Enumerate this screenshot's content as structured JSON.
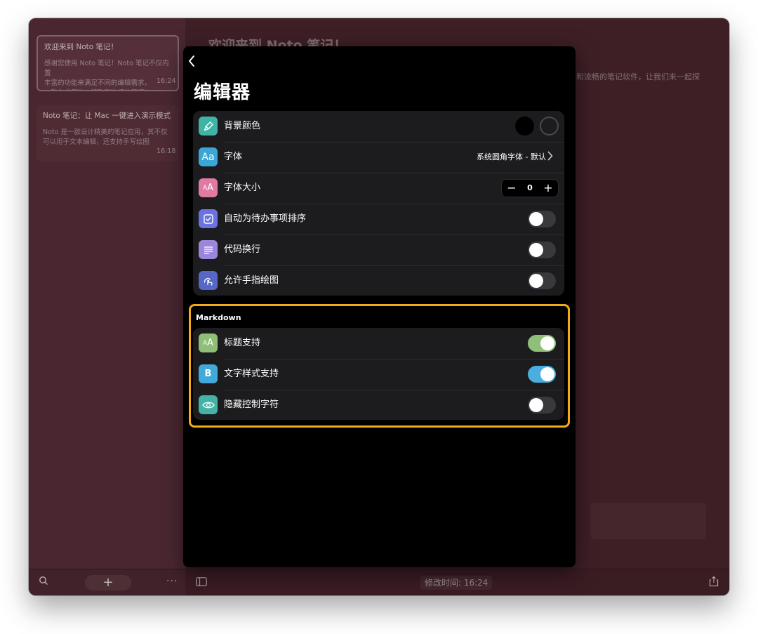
{
  "background": {
    "notes": [
      {
        "title": "欢迎来到 Noto 笔记！",
        "body": "感谢您使用 Noto 笔记！Noto 笔记不仅内置\n丰富的功能来满足不同的编辑需求，\n一款力求简洁、轻致和流畅的笔记i",
        "time": "16:24"
      },
      {
        "title": "Noto 笔记：让 Mac 一键进入演示模式",
        "body": "Noto 是一款设计精美的笔记应用，其不仅\n可以用于文本编辑，还支持手写绘图",
        "time": "16:18"
      }
    ],
    "main_title": "欢迎来到 Noto 笔记！",
    "main_text": "和流畅的笔记软件，让我们来一起探",
    "modified_time": "修改时间: 16:24"
  },
  "modal": {
    "title": "编辑器",
    "general_rows": [
      {
        "label": "背景颜色",
        "icon": "paint-brush-icon",
        "color": "#3fb4a6"
      },
      {
        "label": "字体",
        "icon": "font-aa-icon",
        "color": "#3ba7d7",
        "value": "系统圆角字体 - 默认"
      },
      {
        "label": "字体大小",
        "icon": "font-size-icon",
        "color": "#e07aa3",
        "stepper_value": "0"
      },
      {
        "label": "自动为待办事项排序",
        "icon": "checkbox-icon",
        "color": "#6a73e0",
        "on": false
      },
      {
        "label": "代码换行",
        "icon": "lines-icon",
        "color": "#9b86dc",
        "on": false
      },
      {
        "label": "允许手指绘图",
        "icon": "finger-draw-icon",
        "color": "#5767c7",
        "on": false
      }
    ],
    "markdown_section_label": "Markdown",
    "markdown_rows": [
      {
        "label": "标题支持",
        "icon": "heading-icon",
        "color": "#8fbf77",
        "on": true,
        "accent": "#8fc07a"
      },
      {
        "label": "文字样式支持",
        "icon": "bold-b-icon",
        "color": "#42a9db",
        "on": true,
        "accent": "#4aaedf"
      },
      {
        "label": "隐藏控制字符",
        "icon": "eye-icon",
        "color": "#44b3a7",
        "on": false
      }
    ]
  },
  "colors": {
    "highlight": "#f2ab16",
    "swatch_black": "#000000"
  }
}
